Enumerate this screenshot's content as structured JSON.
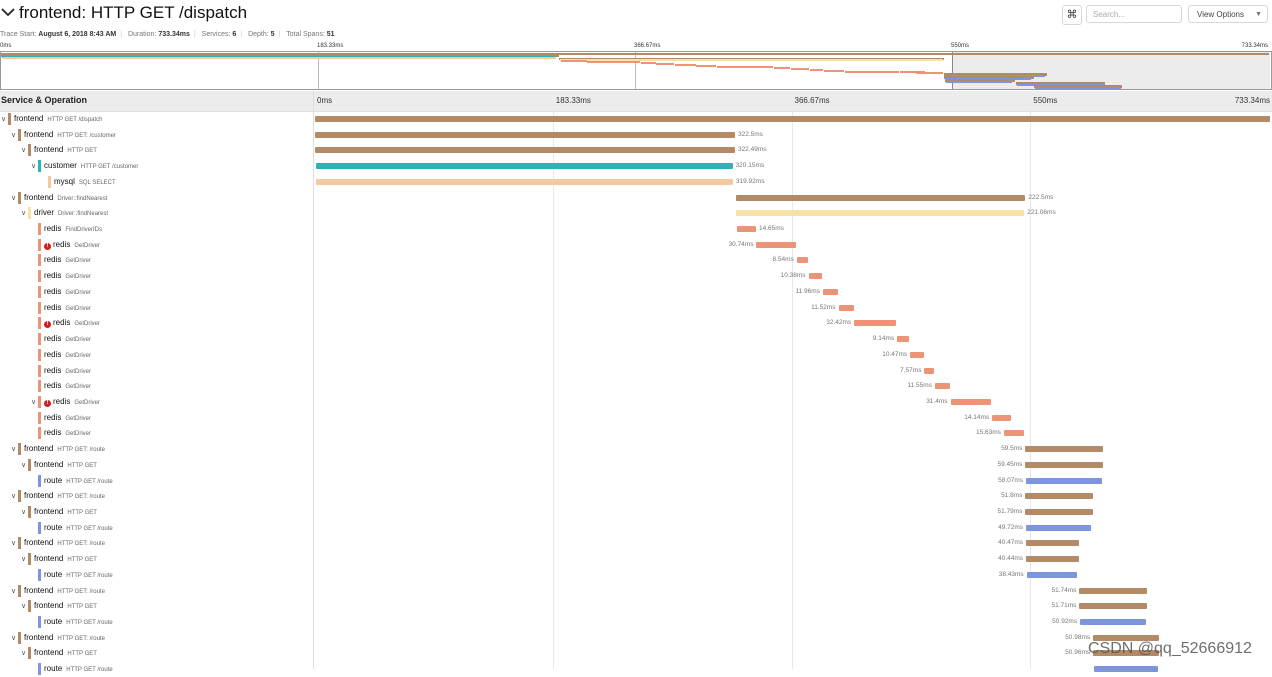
{
  "header": {
    "title": "frontend: HTTP GET /dispatch",
    "kbd_glyph": "⌘",
    "search_placeholder": "Search...",
    "view_options_label": "View Options"
  },
  "meta": {
    "trace_start_label": "Trace Start:",
    "trace_start": "August 6, 2018 8:43 AM",
    "duration_label": "Duration:",
    "duration": "733.34ms",
    "services_label": "Services:",
    "services": "6",
    "depth_label": "Depth:",
    "depth": "5",
    "total_spans_label": "Total Spans:",
    "total_spans": "51"
  },
  "timeline": {
    "column_title": "Service & Operation",
    "ticks": [
      "0ms",
      "183.33ms",
      "366.67ms",
      "550ms",
      "733.34ms"
    ],
    "total_ms": 733.34
  },
  "colors": {
    "frontend": "#b28a66",
    "customer": "#2bb3b8",
    "mysql": "#f5c9a0",
    "driver": "#f8e0a6",
    "redis": "#ee9476",
    "route": "#7c95dd"
  },
  "spans": [
    {
      "service": "frontend",
      "op": "HTTP GET /dispatch",
      "depth": 0,
      "chevron": true,
      "error": false,
      "start": 0,
      "dur": 733.34,
      "label": ""
    },
    {
      "service": "frontend",
      "op": "HTTP GET: /customer",
      "depth": 1,
      "chevron": true,
      "error": false,
      "start": 0,
      "dur": 322.5,
      "label": "322.5ms"
    },
    {
      "service": "frontend",
      "op": "HTTP GET",
      "depth": 2,
      "chevron": true,
      "error": false,
      "start": 0,
      "dur": 322.49,
      "label": "322.49ms"
    },
    {
      "service": "customer",
      "op": "HTTP GET /customer",
      "depth": 3,
      "chevron": true,
      "error": false,
      "start": 0.5,
      "dur": 320.15,
      "label": "320.15ms"
    },
    {
      "service": "mysql",
      "op": "SQL SELECT",
      "depth": 4,
      "chevron": false,
      "error": false,
      "start": 1,
      "dur": 319.92,
      "label": "319.92ms"
    },
    {
      "service": "frontend",
      "op": "Driver::findNearest",
      "depth": 1,
      "chevron": true,
      "error": false,
      "start": 323,
      "dur": 222.5,
      "label": "222.5ms"
    },
    {
      "service": "driver",
      "op": "Driver::findNearest",
      "depth": 2,
      "chevron": true,
      "error": false,
      "start": 323.5,
      "dur": 221.06,
      "label": "221.06ms"
    },
    {
      "service": "redis",
      "op": "FindDriverIDs",
      "depth": 3,
      "chevron": false,
      "error": false,
      "start": 324,
      "dur": 14.65,
      "label": "14.65ms"
    },
    {
      "service": "redis",
      "op": "GetDriver",
      "depth": 3,
      "chevron": false,
      "error": true,
      "start": 339,
      "dur": 30.74,
      "label": "30.74ms"
    },
    {
      "service": "redis",
      "op": "GetDriver",
      "depth": 3,
      "chevron": false,
      "error": false,
      "start": 370,
      "dur": 8.54,
      "label": "8.54ms"
    },
    {
      "service": "redis",
      "op": "GetDriver",
      "depth": 3,
      "chevron": false,
      "error": false,
      "start": 379,
      "dur": 10.38,
      "label": "10.38ms"
    },
    {
      "service": "redis",
      "op": "GetDriver",
      "depth": 3,
      "chevron": false,
      "error": false,
      "start": 390,
      "dur": 11.96,
      "label": "11.96ms"
    },
    {
      "service": "redis",
      "op": "GetDriver",
      "depth": 3,
      "chevron": false,
      "error": false,
      "start": 402,
      "dur": 11.52,
      "label": "11.52ms"
    },
    {
      "service": "redis",
      "op": "GetDriver",
      "depth": 3,
      "chevron": false,
      "error": true,
      "start": 414,
      "dur": 32.42,
      "label": "32.42ms"
    },
    {
      "service": "redis",
      "op": "GetDriver",
      "depth": 3,
      "chevron": false,
      "error": false,
      "start": 447,
      "dur": 9.14,
      "label": "9.14ms"
    },
    {
      "service": "redis",
      "op": "GetDriver",
      "depth": 3,
      "chevron": false,
      "error": false,
      "start": 457,
      "dur": 10.47,
      "label": "10.47ms"
    },
    {
      "service": "redis",
      "op": "GetDriver",
      "depth": 3,
      "chevron": false,
      "error": false,
      "start": 468,
      "dur": 7.57,
      "label": "7.57ms"
    },
    {
      "service": "redis",
      "op": "GetDriver",
      "depth": 3,
      "chevron": false,
      "error": false,
      "start": 476,
      "dur": 11.55,
      "label": "11.55ms"
    },
    {
      "service": "redis",
      "op": "GetDriver",
      "depth": 3,
      "chevron": true,
      "error": true,
      "start": 488,
      "dur": 31.4,
      "label": "31.4ms"
    },
    {
      "service": "redis",
      "op": "GetDriver",
      "depth": 3,
      "chevron": false,
      "error": false,
      "start": 520,
      "dur": 14.14,
      "label": "14.14ms"
    },
    {
      "service": "redis",
      "op": "GetDriver",
      "depth": 3,
      "chevron": false,
      "error": false,
      "start": 529,
      "dur": 15.63,
      "label": "15.63ms"
    },
    {
      "service": "frontend",
      "op": "HTTP GET: /route",
      "depth": 1,
      "chevron": true,
      "error": false,
      "start": 545.5,
      "dur": 59.5,
      "label": "59.5ms"
    },
    {
      "service": "frontend",
      "op": "HTTP GET",
      "depth": 2,
      "chevron": true,
      "error": false,
      "start": 545.5,
      "dur": 59.45,
      "label": "59.45ms"
    },
    {
      "service": "route",
      "op": "HTTP GET /route",
      "depth": 3,
      "chevron": false,
      "error": false,
      "start": 546,
      "dur": 58.07,
      "label": "58.07ms"
    },
    {
      "service": "frontend",
      "op": "HTTP GET: /route",
      "depth": 1,
      "chevron": true,
      "error": false,
      "start": 545.5,
      "dur": 51.8,
      "label": "51.8ms"
    },
    {
      "service": "frontend",
      "op": "HTTP GET",
      "depth": 2,
      "chevron": true,
      "error": false,
      "start": 545.5,
      "dur": 51.79,
      "label": "51.79ms"
    },
    {
      "service": "route",
      "op": "HTTP GET /route",
      "depth": 3,
      "chevron": false,
      "error": false,
      "start": 546,
      "dur": 49.72,
      "label": "49.72ms"
    },
    {
      "service": "frontend",
      "op": "HTTP GET: /route",
      "depth": 1,
      "chevron": true,
      "error": false,
      "start": 546,
      "dur": 40.47,
      "label": "40.47ms"
    },
    {
      "service": "frontend",
      "op": "HTTP GET",
      "depth": 2,
      "chevron": true,
      "error": false,
      "start": 546,
      "dur": 40.44,
      "label": "40.44ms"
    },
    {
      "service": "route",
      "op": "HTTP GET /route",
      "depth": 3,
      "chevron": false,
      "error": false,
      "start": 546.5,
      "dur": 38.43,
      "label": "38.43ms"
    },
    {
      "service": "frontend",
      "op": "HTTP GET: /route",
      "depth": 1,
      "chevron": true,
      "error": false,
      "start": 587,
      "dur": 51.74,
      "label": "51.74ms"
    },
    {
      "service": "frontend",
      "op": "HTTP GET",
      "depth": 2,
      "chevron": true,
      "error": false,
      "start": 587,
      "dur": 51.71,
      "label": "51.71ms"
    },
    {
      "service": "route",
      "op": "HTTP GET /route",
      "depth": 3,
      "chevron": false,
      "error": false,
      "start": 587.5,
      "dur": 50.92,
      "label": "50.92ms"
    },
    {
      "service": "frontend",
      "op": "HTTP GET: /route",
      "depth": 1,
      "chevron": true,
      "error": false,
      "start": 597.5,
      "dur": 50.98,
      "label": "50.98ms"
    },
    {
      "service": "frontend",
      "op": "HTTP GET",
      "depth": 2,
      "chevron": true,
      "error": false,
      "start": 597.5,
      "dur": 50.96,
      "label": "50.96ms"
    },
    {
      "service": "route",
      "op": "HTTP GET /route",
      "depth": 3,
      "chevron": false,
      "error": false,
      "start": 598,
      "dur": 49.5,
      "label": ""
    }
  ],
  "watermark": "CSDN @qq_52666912"
}
